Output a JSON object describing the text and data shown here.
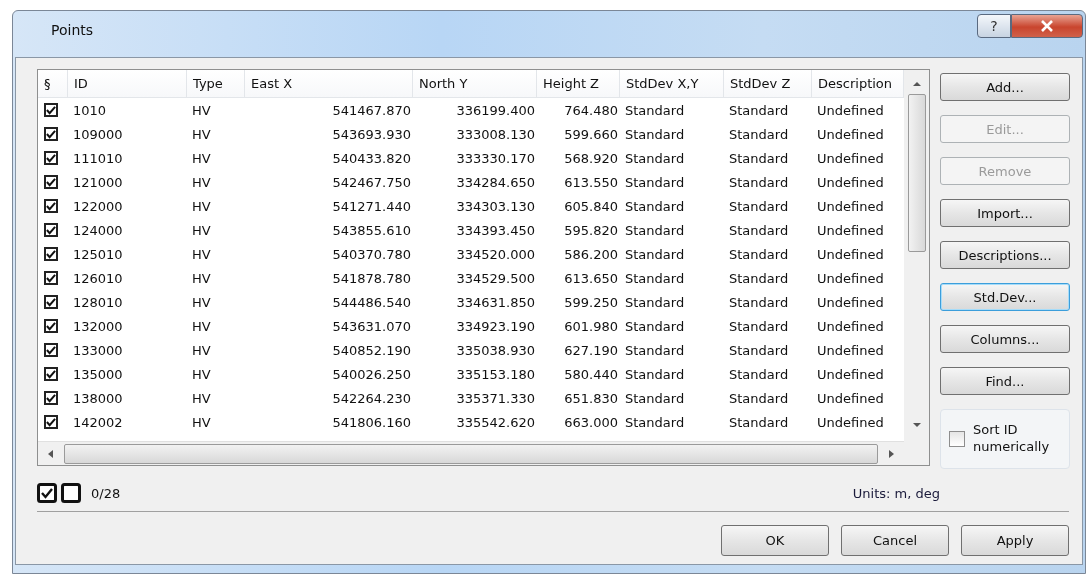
{
  "window": {
    "title": "Points",
    "help": "?"
  },
  "table": {
    "check_header": "§",
    "columns": [
      "ID",
      "Type",
      "East X",
      "North Y",
      "Height Z",
      "StdDev X,Y",
      "StdDev Z",
      "Description"
    ],
    "rows": [
      {
        "checked": true,
        "cells": [
          "1010",
          "HV",
          "541467.870",
          "336199.400",
          "764.480",
          "Standard",
          "Standard",
          "Undefined"
        ]
      },
      {
        "checked": true,
        "cells": [
          "109000",
          "HV",
          "543693.930",
          "333008.130",
          "599.660",
          "Standard",
          "Standard",
          "Undefined"
        ]
      },
      {
        "checked": true,
        "cells": [
          "111010",
          "HV",
          "540433.820",
          "333330.170",
          "568.920",
          "Standard",
          "Standard",
          "Undefined"
        ]
      },
      {
        "checked": true,
        "cells": [
          "121000",
          "HV",
          "542467.750",
          "334284.650",
          "613.550",
          "Standard",
          "Standard",
          "Undefined"
        ]
      },
      {
        "checked": true,
        "cells": [
          "122000",
          "HV",
          "541271.440",
          "334303.130",
          "605.840",
          "Standard",
          "Standard",
          "Undefined"
        ]
      },
      {
        "checked": true,
        "cells": [
          "124000",
          "HV",
          "543855.610",
          "334393.450",
          "595.820",
          "Standard",
          "Standard",
          "Undefined"
        ]
      },
      {
        "checked": true,
        "cells": [
          "125010",
          "HV",
          "540370.780",
          "334520.000",
          "586.200",
          "Standard",
          "Standard",
          "Undefined"
        ]
      },
      {
        "checked": true,
        "cells": [
          "126010",
          "HV",
          "541878.780",
          "334529.500",
          "613.650",
          "Standard",
          "Standard",
          "Undefined"
        ]
      },
      {
        "checked": true,
        "cells": [
          "128010",
          "HV",
          "544486.540",
          "334631.850",
          "599.250",
          "Standard",
          "Standard",
          "Undefined"
        ]
      },
      {
        "checked": true,
        "cells": [
          "132000",
          "HV",
          "543631.070",
          "334923.190",
          "601.980",
          "Standard",
          "Standard",
          "Undefined"
        ]
      },
      {
        "checked": true,
        "cells": [
          "133000",
          "HV",
          "540852.190",
          "335038.930",
          "627.190",
          "Standard",
          "Standard",
          "Undefined"
        ]
      },
      {
        "checked": true,
        "cells": [
          "135000",
          "HV",
          "540026.250",
          "335153.180",
          "580.440",
          "Standard",
          "Standard",
          "Undefined"
        ]
      },
      {
        "checked": true,
        "cells": [
          "138000",
          "HV",
          "542264.230",
          "335371.330",
          "651.830",
          "Standard",
          "Standard",
          "Undefined"
        ]
      },
      {
        "checked": true,
        "cells": [
          "142002",
          "HV",
          "541806.160",
          "335542.620",
          "663.000",
          "Standard",
          "Standard",
          "Undefined"
        ]
      }
    ]
  },
  "side_buttons": [
    {
      "label": "Add...",
      "disabled": false,
      "focused": false
    },
    {
      "label": "Edit...",
      "disabled": true,
      "focused": false
    },
    {
      "label": "Remove",
      "disabled": true,
      "focused": false
    },
    {
      "label": "Import...",
      "disabled": false,
      "focused": false
    },
    {
      "label": "Descriptions...",
      "disabled": false,
      "focused": false
    },
    {
      "label": "Std.Dev...",
      "disabled": false,
      "focused": true
    },
    {
      "label": "Columns...",
      "disabled": false,
      "focused": false
    },
    {
      "label": "Find...",
      "disabled": false,
      "focused": false
    }
  ],
  "sort_option": {
    "label": "Sort ID numerically",
    "checked": false
  },
  "count": "0/28",
  "units": "Units: m, deg",
  "buttons": [
    "OK",
    "Cancel",
    "Apply"
  ]
}
